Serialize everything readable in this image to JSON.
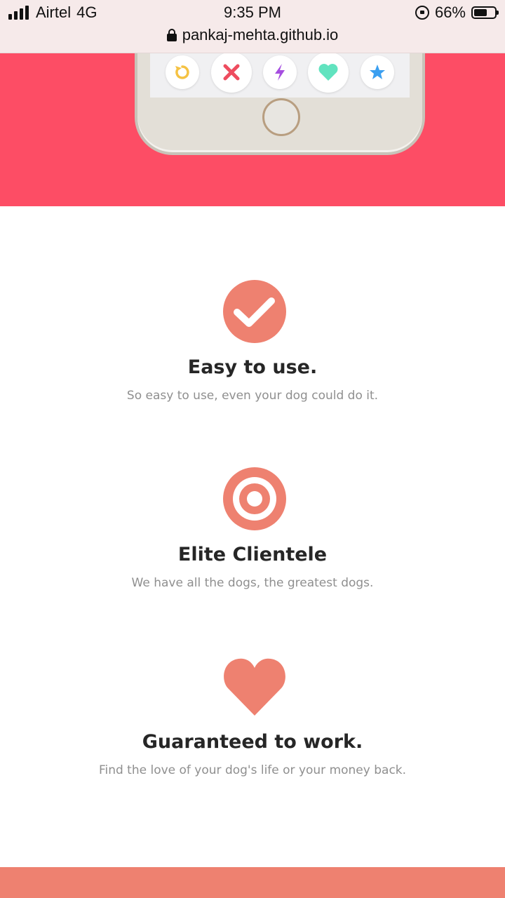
{
  "status_bar": {
    "carrier": "Airtel",
    "network": "4G",
    "time": "9:35 PM",
    "battery_percent": "66%",
    "battery_level": 0.66,
    "url": "pankaj-mehta.github.io"
  },
  "hero": {
    "background_color": "#fd4d65",
    "app_actions": [
      {
        "icon": "rewind-icon",
        "color": "#f5c243"
      },
      {
        "icon": "close-icon",
        "color": "#ee4c5f"
      },
      {
        "icon": "lightning-icon",
        "color": "#a64ee0"
      },
      {
        "icon": "heart-icon",
        "color": "#61e3bf"
      },
      {
        "icon": "star-icon",
        "color": "#3b9ff0"
      }
    ]
  },
  "features": [
    {
      "icon": "check-circle-icon",
      "title": "Easy to use.",
      "description": "So easy to use, even your dog could do it."
    },
    {
      "icon": "target-icon",
      "title": "Elite Clientele",
      "description": "We have all the dogs, the greatest dogs."
    },
    {
      "icon": "heart-icon",
      "title": "Guaranteed to work.",
      "description": "Find the love of your dog's life or your money back."
    }
  ],
  "colors": {
    "accent": "#ee8170",
    "hero": "#fd4d65",
    "title_text": "#262626",
    "body_text": "#8f8f8f"
  }
}
